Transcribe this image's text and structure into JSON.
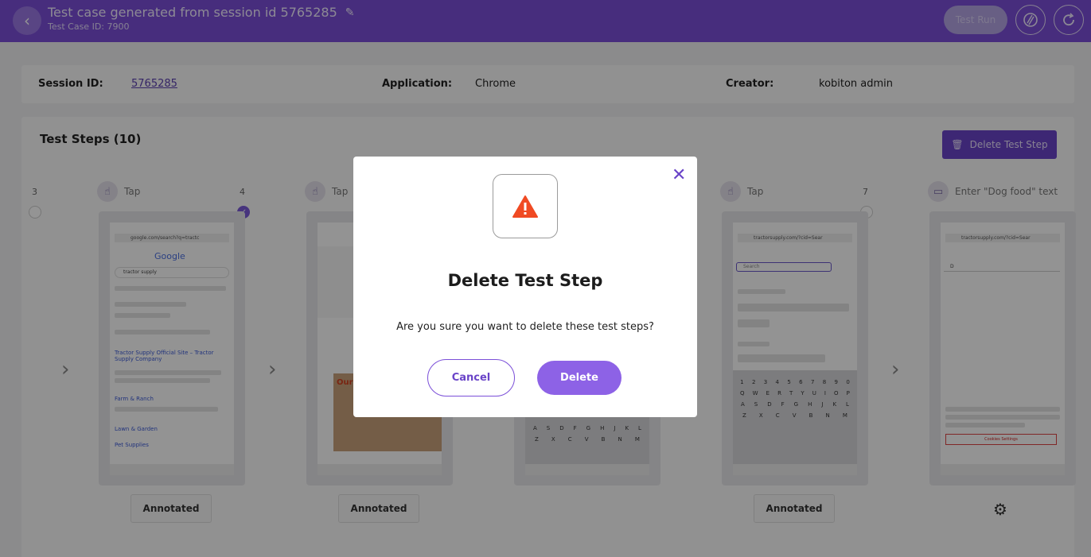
{
  "header": {
    "title": "Test case generated from session id 5765285",
    "subtitle": "Test Case ID: 7900",
    "test_run_label": "Test Run"
  },
  "session": {
    "session_id_label": "Session ID:",
    "session_id_value": "5765285",
    "application_label": "Application:",
    "application_value": "Chrome",
    "creator_label": "Creator:",
    "creator_value": "kobiton admin"
  },
  "steps": {
    "title": "Test Steps (10)",
    "delete_button_label": "Delete Test Step",
    "items": [
      {
        "number": "3",
        "action": "Tap",
        "annotation": "Annotated",
        "selected": false
      },
      {
        "number": "4",
        "action": "Tap",
        "annotation": "Annotated",
        "selected": true
      },
      {
        "number": "",
        "action": "",
        "annotation": "",
        "selected": false
      },
      {
        "number": "",
        "action": "Tap",
        "annotation": "Annotated",
        "selected": false
      },
      {
        "number": "7",
        "action": "Enter \"Dog food\" text",
        "annotation": "",
        "selected": false
      }
    ],
    "screens": {
      "google_url": "google.com/search?q=tractc",
      "google_logo": "Google",
      "google_query": "tractor supply",
      "google_link_1": "Tractor Supply Official Site – Tractor Supply Company",
      "google_link_2": "Farm & Ranch",
      "google_link_3": "Lawn & Garden",
      "google_link_4": "Pet Supplies",
      "tsc_url": "tractorsupply.com/?cid=Sear",
      "tsc_search_value": "D",
      "tsc_placeholder": "Search",
      "cookies_button": "Cookies Settings"
    }
  },
  "modal": {
    "title": "Delete Test Step",
    "message": "Are you sure you want to delete these test steps?",
    "cancel_label": "Cancel",
    "delete_label": "Delete"
  },
  "colors": {
    "brand": "#7b4fd8",
    "warning": "#f04a23"
  }
}
